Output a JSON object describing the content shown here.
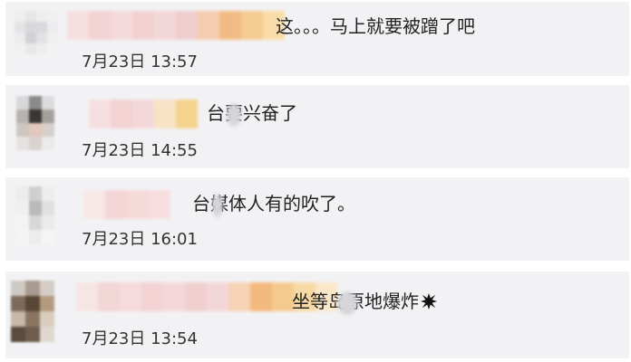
{
  "comments": [
    {
      "text": "这。。。马上就要被蹭了吧",
      "time": "7月23日 13:57"
    },
    {
      "text": "台要兴奋了",
      "time": "7月23日 14:55"
    },
    {
      "text": "台媒体人有的吹了。",
      "time": "7月23日 16:01"
    },
    {
      "text": "坐等岛原地爆炸",
      "time": "7月23日 13:54",
      "emoji": "explosion-icon"
    }
  ],
  "colors": {
    "card_bg": "#f2f2f5",
    "text": "#222222",
    "time": "#333333"
  }
}
